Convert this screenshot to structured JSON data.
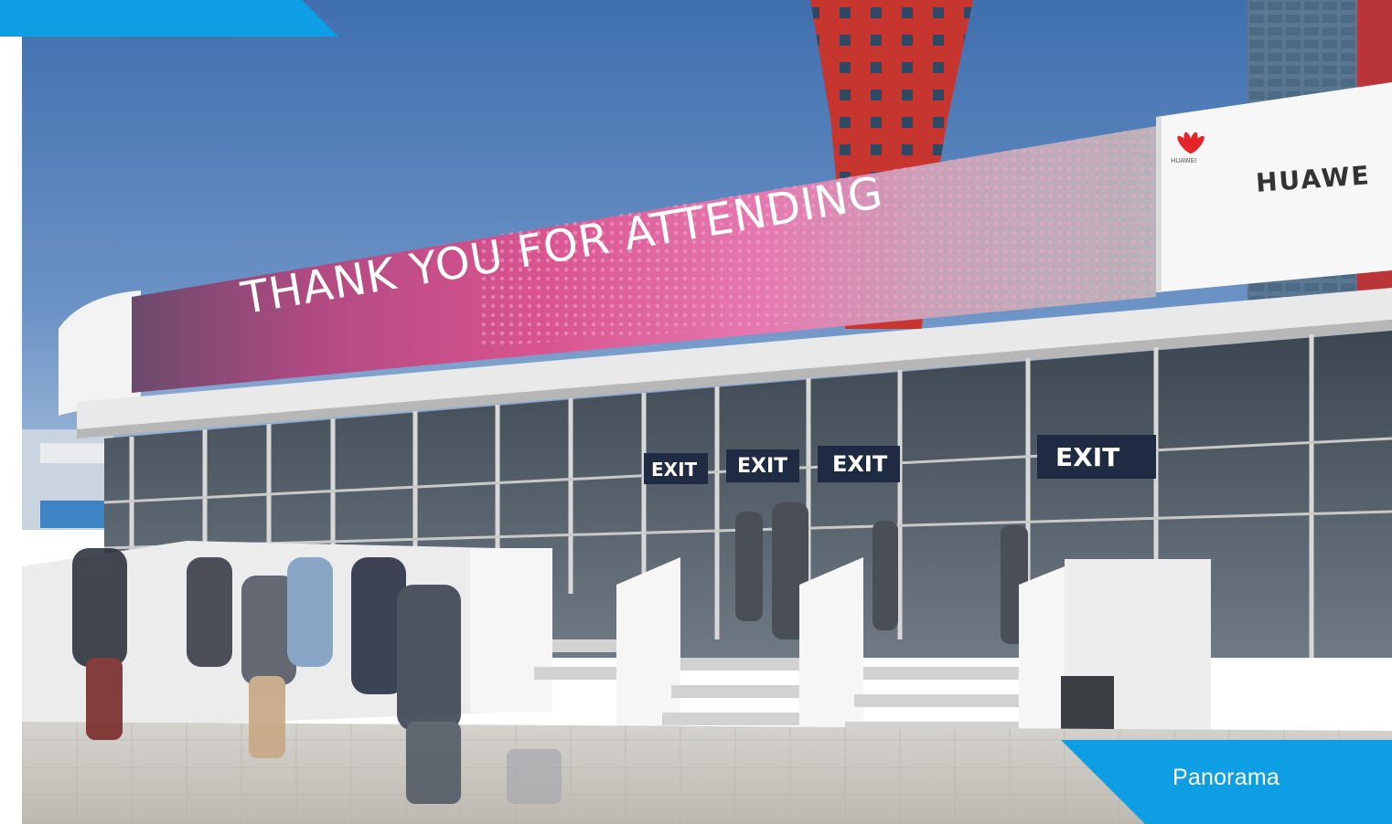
{
  "photo": {
    "description_hidden": "",
    "banner_text": "THANK YOU FOR ATTENDING",
    "brand_text": "HUAWE",
    "brand_small_text": "HUAWEI",
    "exit_signs": [
      "EXIT",
      "EXIT",
      "EXIT",
      "EXIT"
    ]
  },
  "caption": {
    "label": "Panorama"
  },
  "colors": {
    "accent": "#0e9ee3",
    "sky": "#4a7bb8",
    "banner_pink": "#d94a8c",
    "tower_red": "#c8352f",
    "huawei_red": "#e3242b"
  },
  "icons": {
    "brand_logo": "huawei-flower-icon"
  }
}
